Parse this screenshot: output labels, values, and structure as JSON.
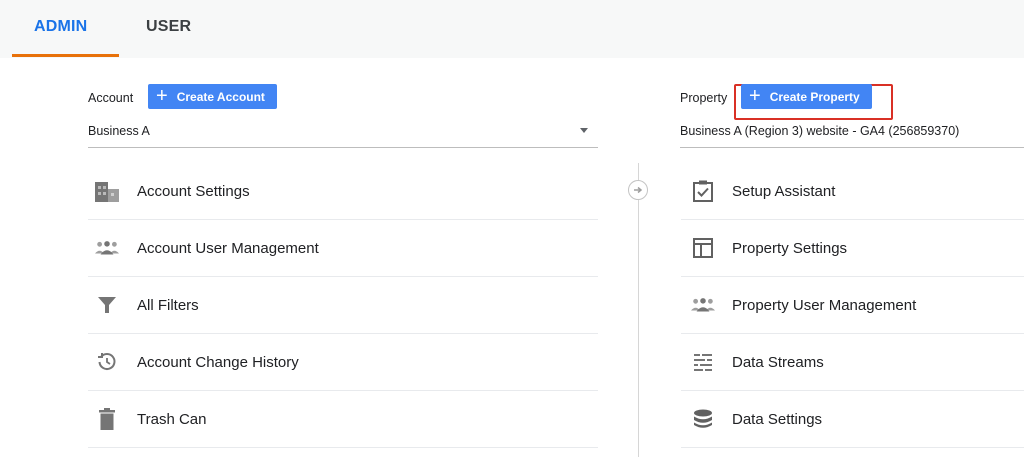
{
  "tabs": {
    "admin": "ADMIN",
    "user": "USER"
  },
  "account": {
    "label": "Account",
    "create_label": "Create Account",
    "selected": "Business A",
    "items": [
      {
        "label": "Account Settings",
        "icon": "building-icon"
      },
      {
        "label": "Account User Management",
        "icon": "people-icon"
      },
      {
        "label": "All Filters",
        "icon": "filter-icon"
      },
      {
        "label": "Account Change History",
        "icon": "history-icon"
      },
      {
        "label": "Trash Can",
        "icon": "trash-icon"
      }
    ]
  },
  "property": {
    "label": "Property",
    "create_label": "Create Property",
    "selected": "Business A (Region 3) website - GA4 (256859370)",
    "items": [
      {
        "label": "Setup Assistant",
        "icon": "checkbox-clipboard-icon"
      },
      {
        "label": "Property Settings",
        "icon": "layout-icon"
      },
      {
        "label": "Property User Management",
        "icon": "people-icon"
      },
      {
        "label": "Data Streams",
        "icon": "data-streams-icon"
      },
      {
        "label": "Data Settings",
        "icon": "database-icon"
      }
    ]
  },
  "colors": {
    "accent": "#1a73e8",
    "button": "#4285f4",
    "tab_underline": "#e8710a",
    "highlight": "#d93025",
    "icon_gray": "#757575"
  }
}
